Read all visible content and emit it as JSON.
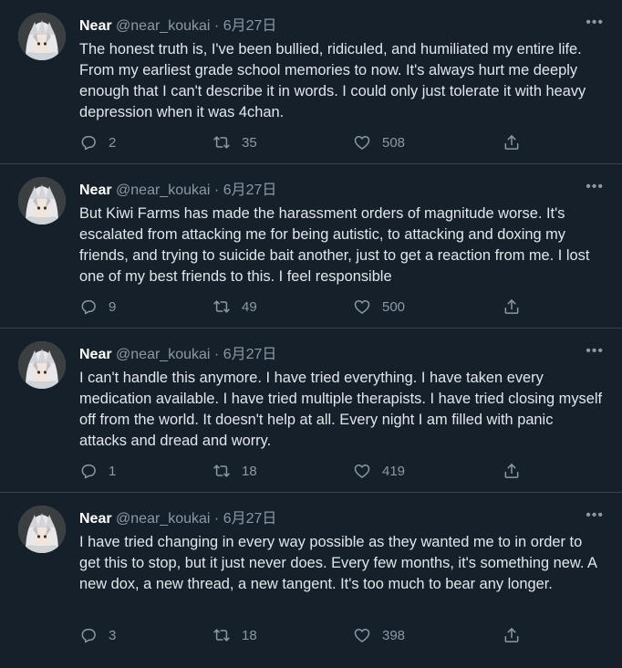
{
  "tweets": [
    {
      "name": "Near",
      "handle": "@near_koukai",
      "separator": "·",
      "date": "6月27日",
      "more": "•••",
      "text": "The honest truth is, I've been bullied, ridiculed, and humiliated my entire life. From my earliest grade school memories to now. It's always hurt me deeply enough that I can't describe it in words. I could only just tolerate it with heavy depression when it was 4chan.",
      "replies": "2",
      "retweets": "35",
      "likes": "508"
    },
    {
      "name": "Near",
      "handle": "@near_koukai",
      "separator": "·",
      "date": "6月27日",
      "more": "•••",
      "text": "But Kiwi Farms has made the harassment orders of magnitude worse. It's escalated from attacking me for being autistic, to attacking and doxing my friends, and trying to suicide bait another, just to get a reaction from me. I lost one of my best friends to this. I feel responsible",
      "replies": "9",
      "retweets": "49",
      "likes": "500"
    },
    {
      "name": "Near",
      "handle": "@near_koukai",
      "separator": "·",
      "date": "6月27日",
      "more": "•••",
      "text": "I can't handle this anymore. I have tried everything. I have taken every medication available. I have tried multiple therapists. I have tried closing myself off from the world. It doesn't help at all. Every night I am filled with panic attacks and dread and worry.",
      "replies": "1",
      "retweets": "18",
      "likes": "419"
    },
    {
      "name": "Near",
      "handle": "@near_koukai",
      "separator": "·",
      "date": "6月27日",
      "more": "•••",
      "text": "I have tried changing in every way possible as they wanted me to in order to get this to stop, but it just never does. Every few months, it's something new. A new dox, a new thread, a new tangent. It's too much to bear any longer.",
      "replies": "3",
      "retweets": "18",
      "likes": "398"
    }
  ],
  "icons": {
    "reply": "reply-icon",
    "retweet": "retweet-icon",
    "like": "heart-icon",
    "share": "share-icon"
  },
  "colors": {
    "background": "#15202b",
    "text": "#e1e6ea",
    "secondary": "#8b98a5",
    "divider": "#38444d"
  }
}
